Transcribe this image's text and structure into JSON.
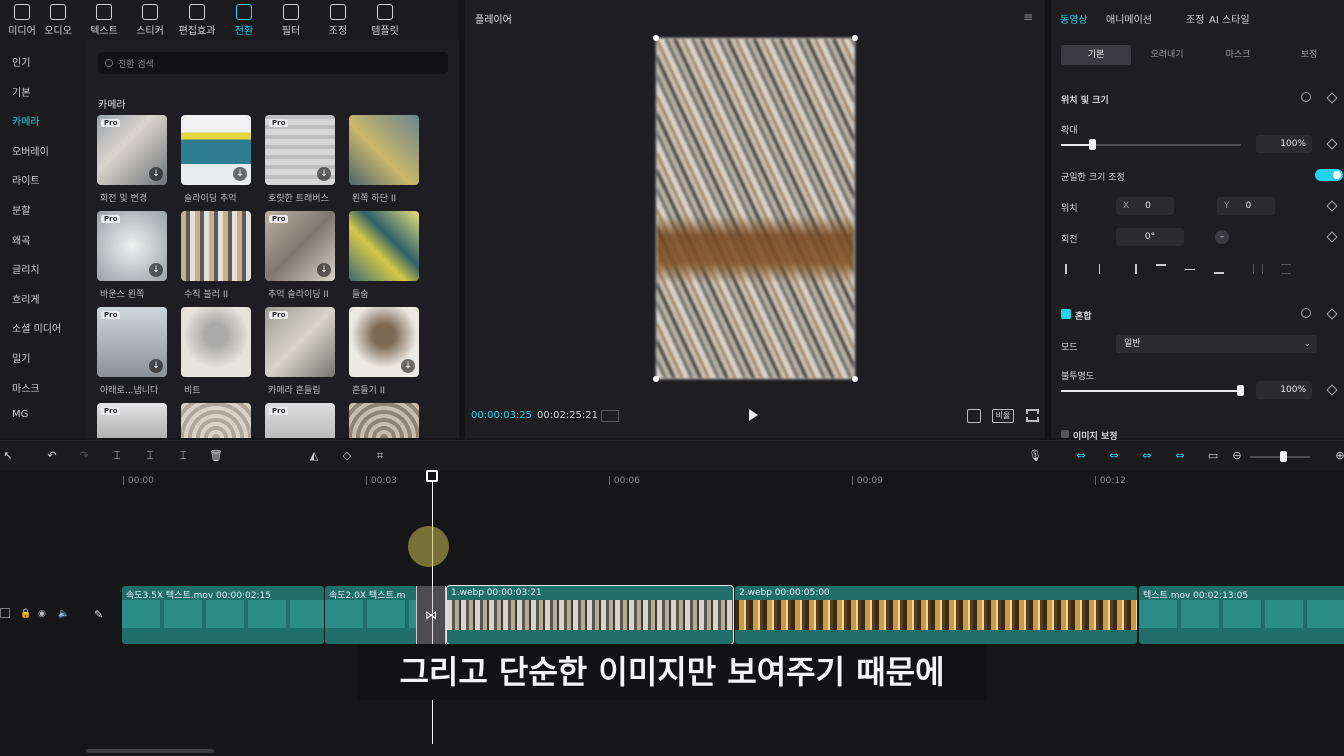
{
  "toolbar": {
    "tools": [
      {
        "label": "미디어",
        "icon": "media-icon"
      },
      {
        "label": "오디오",
        "icon": "audio-icon"
      },
      {
        "label": "텍스트",
        "icon": "text-icon"
      },
      {
        "label": "스티커",
        "icon": "sticker-icon"
      },
      {
        "label": "편집효과",
        "icon": "effects-icon"
      },
      {
        "label": "전환",
        "icon": "transition-icon",
        "active": true
      },
      {
        "label": "필터",
        "icon": "filter-icon"
      },
      {
        "label": "조정",
        "icon": "adjust-icon"
      },
      {
        "label": "템플릿",
        "icon": "template-icon"
      }
    ]
  },
  "sidebar": {
    "categories": [
      "인기",
      "기본",
      "카메라",
      "오버레이",
      "라이트",
      "분할",
      "왜곡",
      "글리치",
      "흐리게",
      "소셜 미디어",
      "밀기",
      "마스크",
      "MG"
    ],
    "active": "카메라"
  },
  "transitions": {
    "search_placeholder": "전환 검색",
    "section_title": "카메라",
    "pro_badge": "Pro",
    "items": [
      {
        "label": "회전 및 변경",
        "pro": true,
        "download": true
      },
      {
        "label": "슬라이딩 추억",
        "pro": false,
        "download": true
      },
      {
        "label": "호릿한 트래버스",
        "pro": true,
        "download": true
      },
      {
        "label": "왼쪽 하단 II",
        "pro": false,
        "download": false
      },
      {
        "label": "바운스 왼쪽",
        "pro": true,
        "download": true
      },
      {
        "label": "수직 블러 II",
        "pro": false,
        "download": false
      },
      {
        "label": "추억 슬라이딩 II",
        "pro": true,
        "download": true
      },
      {
        "label": "들숨",
        "pro": false,
        "download": false
      },
      {
        "label": "아래로...냅니다",
        "pro": true,
        "download": true
      },
      {
        "label": "비트",
        "pro": false,
        "download": false
      },
      {
        "label": "카메라 흔들림",
        "pro": true,
        "download": false
      },
      {
        "label": "흔들기 II",
        "pro": false,
        "download": true
      },
      {
        "label": "",
        "pro": true,
        "download": false
      },
      {
        "label": "",
        "pro": false,
        "download": false
      },
      {
        "label": "",
        "pro": true,
        "download": false
      },
      {
        "label": "",
        "pro": false,
        "download": false
      }
    ]
  },
  "player": {
    "title": "플레이어",
    "current_time": "00:00:03:25",
    "duration": "00:02:25:21",
    "ratio_label": "비율"
  },
  "properties": {
    "tabs": [
      {
        "label": "동영상",
        "active": true
      },
      {
        "label": "애니메이션"
      },
      {
        "label": "조정"
      },
      {
        "label": "AI 스타일"
      }
    ],
    "subtabs": [
      {
        "label": "기본",
        "active": true
      },
      {
        "label": "오려내기"
      },
      {
        "label": "마스크"
      },
      {
        "label": "보정"
      }
    ],
    "position_size_label": "위치 및 크기",
    "scale_label": "확대",
    "scale_value": "100%",
    "scale_fraction": 0.18,
    "uniform_scale_label": "균일한 크기 조정",
    "position_label": "위치",
    "x_label": "X",
    "x_value": "0",
    "y_label": "Y",
    "y_value": "0",
    "rotation_label": "회전",
    "rotation_value": "0°",
    "blend_label": "혼합",
    "mode_label": "모드",
    "mode_value": "일반",
    "opacity_label": "불투명도",
    "opacity_value": "100%",
    "opacity_fraction": 1.0,
    "stabilize_label": "이미지 보정",
    "accent_color": "#22d3ee"
  },
  "timeline": {
    "ticks": [
      "00:00",
      "00:03",
      "00:06",
      "00:09",
      "00:12"
    ],
    "clips": [
      {
        "header": "속도3.5X  텍스트.mov  00:00:02:15",
        "kind": "audio"
      },
      {
        "header": "속도2.0X  텍스트.m",
        "kind": "audio"
      },
      {
        "header": "1.webp  00:00:03:21",
        "kind": "image1"
      },
      {
        "header": "2.webp  00:00:05:00",
        "kind": "image2"
      },
      {
        "header": "텍스트.mov  00:02:13:05",
        "kind": "audio"
      }
    ]
  },
  "subtitle": "그리고 단순한 이미지만 보여주기 때문에"
}
